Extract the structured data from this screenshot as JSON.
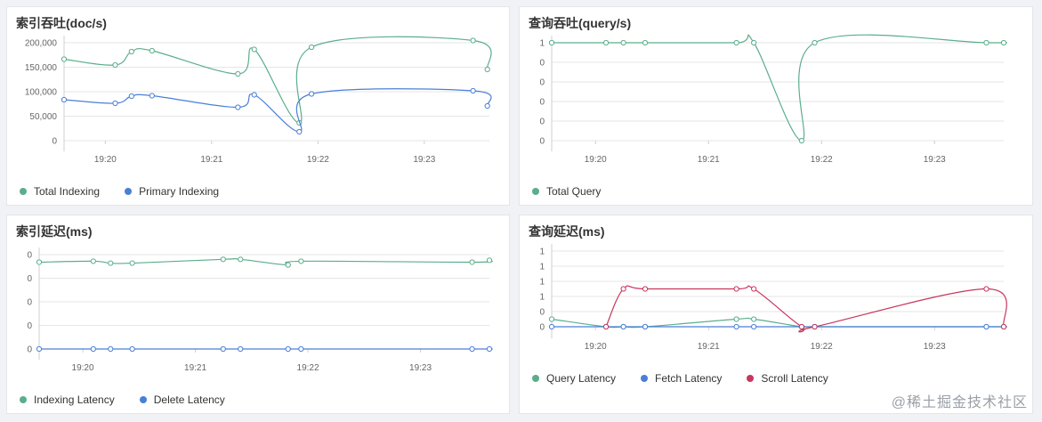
{
  "charts": [
    {
      "id": "indexing-throughput",
      "title": "索引吞吐(doc/s)",
      "type": "line",
      "x_ticks": [
        "19:20",
        "19:21",
        "19:22",
        "19:23"
      ],
      "y_ticks": [
        "0",
        "50,000",
        "100,000",
        "150,000",
        "200,000"
      ],
      "ylim": [
        0,
        220000
      ],
      "xlim": [
        0,
        100
      ],
      "x_tick_positions": [
        0,
        0,
        0,
        0
      ],
      "series": [
        {
          "name": "Total Indexing",
          "color": "#5aae8b",
          "x": [
            0,
            12.5,
            16.5,
            21.5,
            42.5,
            46.5,
            57.5,
            60.5,
            100,
            103.5
          ],
          "y": [
            183000,
            170000,
            200000,
            202000,
            150000,
            205000,
            40000,
            210000,
            225000,
            160000
          ]
        },
        {
          "name": "Primary Indexing",
          "color": "#4a7fd6",
          "x": [
            0,
            12.5,
            16.5,
            21.5,
            42.5,
            46.5,
            57.5,
            60.5,
            100,
            103.5
          ],
          "y": [
            92000,
            84000,
            100000,
            101000,
            75000,
            103000,
            20000,
            105000,
            112000,
            78000
          ]
        }
      ]
    },
    {
      "id": "query-throughput",
      "title": "查询吞吐(query/s)",
      "type": "line",
      "x_ticks": [
        "19:20",
        "19:21",
        "19:22",
        "19:23"
      ],
      "y_ticks": [
        "0",
        "0",
        "0",
        "0",
        "0",
        "1"
      ],
      "ylim": [
        0,
        1
      ],
      "xlim": [
        0,
        100
      ],
      "series": [
        {
          "name": "Total Query",
          "color": "#5aae8b",
          "x": [
            0,
            12.5,
            16.5,
            21.5,
            42.5,
            46.5,
            57.5,
            60.5,
            100,
            104
          ],
          "y": [
            1,
            1,
            1,
            1,
            1,
            1,
            0,
            1,
            1,
            1
          ]
        }
      ]
    },
    {
      "id": "indexing-latency",
      "title": "索引延迟(ms)",
      "type": "line",
      "x_ticks": [
        "19:20",
        "19:21",
        "19:22",
        "19:23"
      ],
      "y_ticks": [
        "0",
        "0",
        "0",
        "0",
        "0"
      ],
      "ylim": [
        0,
        1
      ],
      "xlim": [
        0,
        100
      ],
      "series": [
        {
          "name": "Indexing Latency",
          "color": "#5aae8b",
          "x": [
            0,
            12.5,
            16.5,
            21.5,
            42.5,
            46.5,
            57.5,
            60.5,
            100,
            104
          ],
          "y": [
            0.92,
            0.93,
            0.91,
            0.91,
            0.95,
            0.95,
            0.89,
            0.93,
            0.92,
            0.94
          ]
        },
        {
          "name": "Delete Latency",
          "color": "#4a7fd6",
          "x": [
            0,
            12.5,
            16.5,
            21.5,
            42.5,
            46.5,
            57.5,
            60.5,
            100,
            104
          ],
          "y": [
            0,
            0,
            0,
            0,
            0,
            0,
            0,
            0,
            0,
            0
          ]
        }
      ]
    },
    {
      "id": "query-latency",
      "title": "查询延迟(ms)",
      "type": "line",
      "x_ticks": [
        "19:20",
        "19:21",
        "19:22",
        "19:23"
      ],
      "y_ticks": [
        "0",
        "0",
        "1",
        "1",
        "1",
        "1"
      ],
      "ylim": [
        0,
        1
      ],
      "xlim": [
        0,
        100
      ],
      "series": [
        {
          "name": "Query Latency",
          "color": "#5aae8b",
          "x": [
            0,
            12.5,
            16.5,
            21.5,
            42.5,
            46.5,
            57.5,
            60.5,
            100,
            104
          ],
          "y": [
            0.1,
            0,
            0,
            0,
            0.1,
            0.1,
            0,
            0,
            0,
            0
          ]
        },
        {
          "name": "Fetch Latency",
          "color": "#4a7fd6",
          "x": [
            0,
            12.5,
            16.5,
            21.5,
            42.5,
            46.5,
            57.5,
            60.5,
            100,
            104
          ],
          "y": [
            0,
            0,
            0,
            0,
            0,
            0,
            0,
            0,
            0,
            0
          ]
        },
        {
          "name": "Scroll Latency",
          "color": "#c8365e",
          "x": [
            12.5,
            16.5,
            21.5,
            42.5,
            46.5,
            57.5,
            60.5,
            100,
            104
          ],
          "y": [
            0,
            0.5,
            0.5,
            0.5,
            0.5,
            0,
            0,
            0.5,
            0
          ]
        }
      ]
    }
  ],
  "watermark": "@稀土掘金技术社区"
}
